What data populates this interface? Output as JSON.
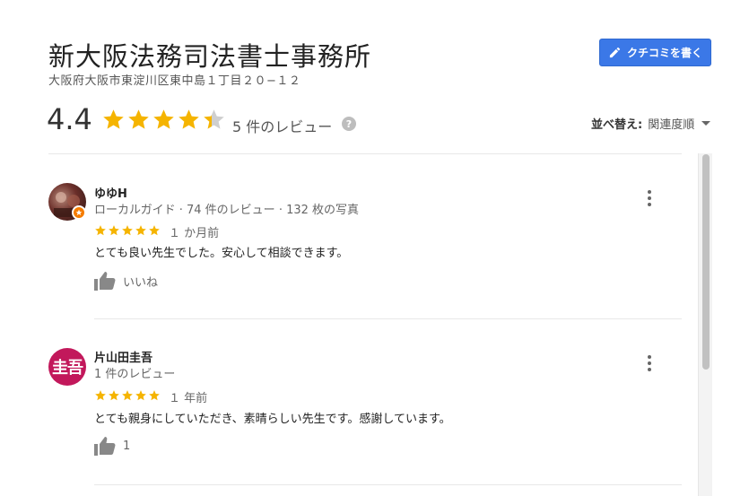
{
  "place": {
    "title": "新大阪法務司法書士事務所",
    "address": "大阪府大阪市東淀川区東中島１丁目２０−１２"
  },
  "actions": {
    "write_review_label": "クチコミを書く"
  },
  "summary": {
    "rating": "4.4",
    "rating_value": 4.4,
    "review_count_label": "5 件のレビュー",
    "help": "?"
  },
  "sort": {
    "label": "並べ替え:",
    "value": "関連度順"
  },
  "reviews": [
    {
      "author": "ゆゆH",
      "meta": "ローカルガイド · 74 件のレビュー · 132 枚の写真",
      "stars": 5,
      "time": "１ か月前",
      "text": "とても良い先生でした。安心して相談できます。",
      "like_label": "いいね",
      "local_guide": true
    },
    {
      "author": "片山田圭吾",
      "avatar_text": "圭吾",
      "meta": "1 件のレビュー",
      "stars": 5,
      "time": "１ 年前",
      "text": "とても親身にしていただき、素晴らしい先生です。感謝しています。",
      "like_label": "1",
      "local_guide": false
    }
  ],
  "colors": {
    "star": "#f5b400",
    "star_empty": "#cfcfcf",
    "button": "#3b78e7",
    "avatar_bg": "#c2185b",
    "badge": "#f57c00"
  }
}
